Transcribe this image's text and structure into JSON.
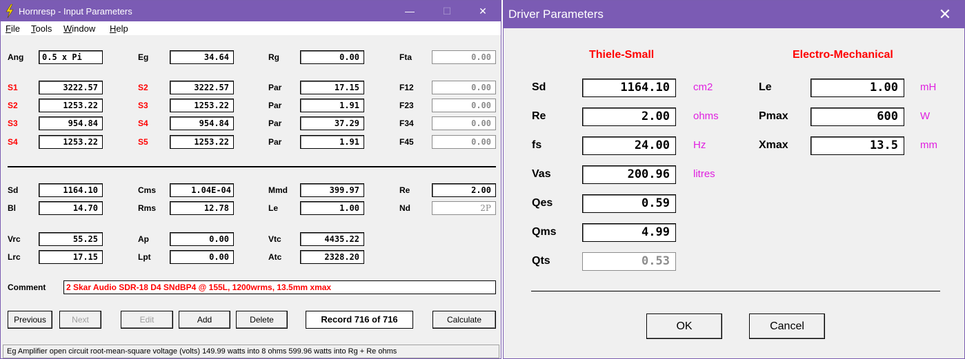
{
  "hornresp": {
    "title": "Hornresp - Input Parameters",
    "window_controls": {
      "minimize": "—",
      "maximize": "☐",
      "close": "✕"
    },
    "menu": [
      "File",
      "Tools",
      "Window",
      "Help"
    ],
    "rows": {
      "ang": {
        "label": "Ang",
        "value": "0.5 x Pi"
      },
      "eg": {
        "label": "Eg",
        "value": "34.64"
      },
      "rg": {
        "label": "Rg",
        "value": "0.00"
      },
      "fta": {
        "label": "Fta",
        "value": "0.00"
      }
    },
    "segments": [
      {
        "a_label": "S1",
        "a_value": "3222.57",
        "b_label": "S2",
        "b_value": "3222.57",
        "c_label": "Par",
        "c_value": "17.15",
        "d_label": "F12",
        "d_value": "0.00"
      },
      {
        "a_label": "S2",
        "a_value": "1253.22",
        "b_label": "S3",
        "b_value": "1253.22",
        "c_label": "Par",
        "c_value": "1.91",
        "d_label": "F23",
        "d_value": "0.00"
      },
      {
        "a_label": "S3",
        "a_value": "954.84",
        "b_label": "S4",
        "b_value": "954.84",
        "c_label": "Par",
        "c_value": "37.29",
        "d_label": "F34",
        "d_value": "0.00"
      },
      {
        "a_label": "S4",
        "a_value": "1253.22",
        "b_label": "S5",
        "b_value": "1253.22",
        "c_label": "Par",
        "c_value": "1.91",
        "d_label": "F45",
        "d_value": "0.00"
      }
    ],
    "driver": {
      "sd": {
        "label": "Sd",
        "value": "1164.10"
      },
      "bl": {
        "label": "Bl",
        "value": "14.70"
      },
      "cms": {
        "label": "Cms",
        "value": "1.04E-04"
      },
      "rms": {
        "label": "Rms",
        "value": "12.78"
      },
      "mmd": {
        "label": "Mmd",
        "value": "399.97"
      },
      "le": {
        "label": "Le",
        "value": "1.00"
      },
      "re": {
        "label": "Re",
        "value": "2.00"
      },
      "nd": {
        "label": "Nd",
        "value": "2P"
      }
    },
    "chambers": {
      "vrc": {
        "label": "Vrc",
        "value": "55.25"
      },
      "lrc": {
        "label": "Lrc",
        "value": "17.15"
      },
      "ap": {
        "label": "Ap",
        "value": "0.00"
      },
      "lpt": {
        "label": "Lpt",
        "value": "0.00"
      },
      "vtc": {
        "label": "Vtc",
        "value": "4435.22"
      },
      "atc": {
        "label": "Atc",
        "value": "2328.20"
      }
    },
    "comment_label": "Comment",
    "comment_value": "2 Skar Audio SDR-18 D4 SNdBP4 @ 155L, 1200wrms, 13.5mm xmax",
    "buttons": {
      "previous": "Previous",
      "next": "Next",
      "edit": "Edit",
      "add": "Add",
      "delete": "Delete",
      "calculate": "Calculate"
    },
    "record": "Record 716 of 716",
    "status": "Eg  Amplifier open circuit root-mean-square voltage  (volts)  149.99 watts into 8 ohms   599.96 watts into Rg + Re ohms"
  },
  "driver_dialog": {
    "title": "Driver Parameters",
    "close": "✕",
    "thiele_small_header": "Thiele-Small",
    "electro_mech_header": "Electro-Mechanical",
    "ts": [
      {
        "label": "Sd",
        "value": "1164.10",
        "unit": "cm2"
      },
      {
        "label": "Re",
        "value": "2.00",
        "unit": "ohms"
      },
      {
        "label": "fs",
        "value": "24.00",
        "unit": "Hz"
      },
      {
        "label": "Vas",
        "value": "200.96",
        "unit": "litres"
      },
      {
        "label": "Qes",
        "value": "0.59",
        "unit": ""
      },
      {
        "label": "Qms",
        "value": "4.99",
        "unit": ""
      },
      {
        "label": "Qts",
        "value": "0.53",
        "unit": ""
      }
    ],
    "em": [
      {
        "label": "Le",
        "value": "1.00",
        "unit": "mH"
      },
      {
        "label": "Pmax",
        "value": "600",
        "unit": "W"
      },
      {
        "label": "Xmax",
        "value": "13.5",
        "unit": "mm"
      }
    ],
    "ok": "OK",
    "cancel": "Cancel"
  },
  "colors": {
    "titlebar": "#7b5bb4",
    "red_label": "#ff0000",
    "unit_magenta": "#e020e0"
  },
  "icons": {
    "app": "lightning-bolt-icon"
  }
}
